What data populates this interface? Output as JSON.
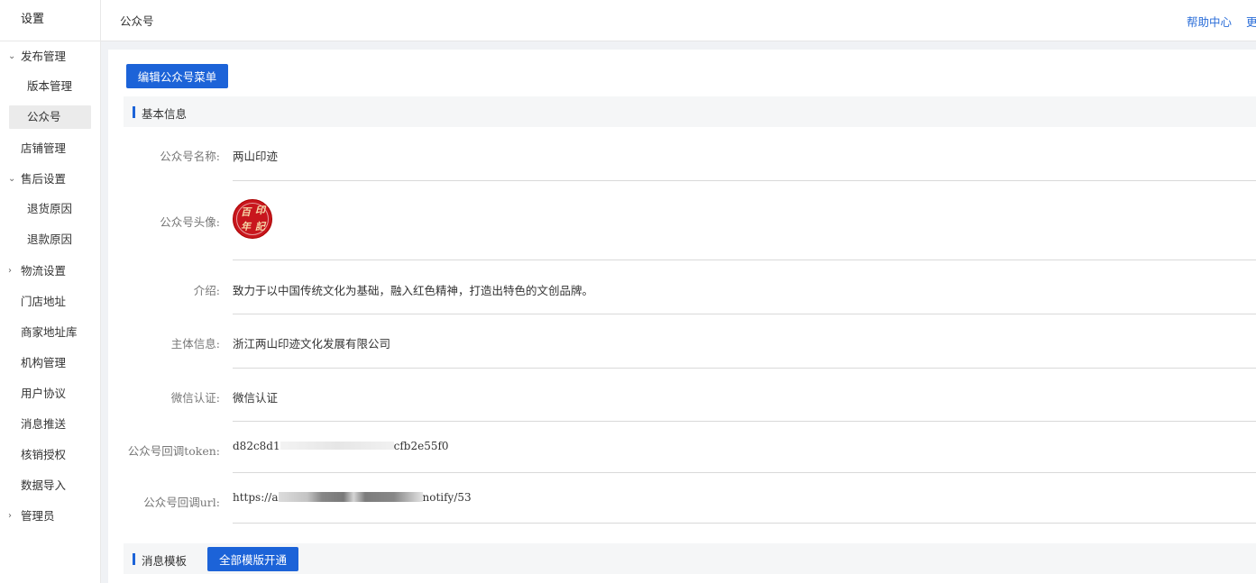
{
  "sidebar": {
    "title": "设置",
    "items": [
      {
        "label": "发布管理",
        "caret": "⌄"
      },
      {
        "label": "版本管理"
      },
      {
        "label": "公众号"
      },
      {
        "label": "店铺管理"
      },
      {
        "label": "售后设置",
        "caret": "⌄"
      },
      {
        "label": "退货原因"
      },
      {
        "label": "退款原因"
      },
      {
        "label": "物流设置",
        "caret": "›"
      },
      {
        "label": "门店地址"
      },
      {
        "label": "商家地址库"
      },
      {
        "label": "机构管理"
      },
      {
        "label": "用户协议"
      },
      {
        "label": "消息推送"
      },
      {
        "label": "核销授权"
      },
      {
        "label": "数据导入"
      },
      {
        "label": "管理员",
        "caret": "›"
      }
    ],
    "active_item": "公众号"
  },
  "header": {
    "page_title": "公众号",
    "help_link": "帮助中心",
    "more_link": "更"
  },
  "main": {
    "edit_menu_button": "编辑公众号菜单",
    "basic_section_title": "基本信息",
    "fields": {
      "name_label": "公众号名称:",
      "name_value": "两山印迹",
      "avatar_label": "公众号头像:",
      "avatar_seal_chars": [
        "百",
        "印",
        "年",
        "記"
      ],
      "intro_label": "介绍:",
      "intro_value": "致力于以中国传统文化为基础，融入红色精神，打造出特色的文创品牌。",
      "entity_label": "主体信息:",
      "entity_value": "浙江两山印迹文化发展有限公司",
      "wechat_verify_label": "微信认证:",
      "wechat_verify_value": "微信认证",
      "token_label": "公众号回调token:",
      "token_value_start": "d82c8d1",
      "token_value_end": "cfb2e55f0",
      "url_label": "公众号回调url:",
      "url_value_start": "https://a",
      "url_value_end": "notify/53"
    },
    "message_section_title": "消息模板",
    "all_templates_button": "全部模版开通"
  },
  "colors": {
    "primary": "#1c63d8",
    "link": "#2a6dd8",
    "seal_red": "#c8161d"
  }
}
